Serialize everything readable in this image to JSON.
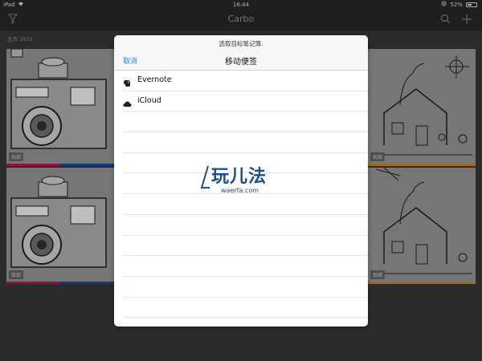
{
  "status_bar": {
    "device": "iPad",
    "time": "16:44",
    "battery": "52%",
    "battery_fraction": 0.52
  },
  "navbar": {
    "title": "Carbo"
  },
  "section": {
    "label": "五月 2015"
  },
  "cards": [
    {
      "tag": "局部",
      "bar_color": "#c8174a"
    },
    {
      "tag": "局部",
      "bar_color": "#e38a1c"
    },
    {
      "tag": "局部",
      "bar_color": "#c8174a"
    },
    {
      "tag": "局部",
      "bar_color": "#e38a1c"
    }
  ],
  "modal": {
    "prompt": "选取目标笔记簿.",
    "cancel_label": "取消",
    "title": "移动便签",
    "items": [
      {
        "label": "Evernote",
        "icon": "evernote-elephant-icon"
      },
      {
        "label": "iCloud",
        "icon": "cloud-icon"
      }
    ]
  },
  "watermark": {
    "main": "玩儿法",
    "sub": "waerfa.com"
  },
  "colors": {
    "accent": "#1a8cff",
    "watermark": "#1e4f86",
    "red_bar": "#c8174a",
    "blue_bar": "#1f49a8",
    "orange_bar": "#e38a1c"
  }
}
